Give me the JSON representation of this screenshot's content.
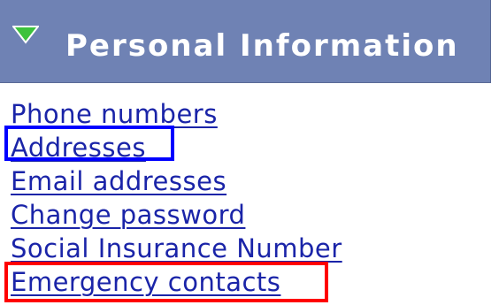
{
  "section": {
    "title": "Personal Information",
    "icon": "expand-triangle-icon",
    "header_color": "#6f82b4",
    "icon_color": "#3cc23c"
  },
  "links": [
    {
      "label": "Phone numbers"
    },
    {
      "label": "Addresses"
    },
    {
      "label": "Email addresses"
    },
    {
      "label": "Change password"
    },
    {
      "label": "Social Insurance Number"
    },
    {
      "label": "Emergency contacts"
    }
  ],
  "highlights": {
    "blue": {
      "target": "Addresses",
      "color": "#0000ff"
    },
    "red": {
      "target": "Emergency contacts",
      "color": "#ff0000"
    }
  }
}
